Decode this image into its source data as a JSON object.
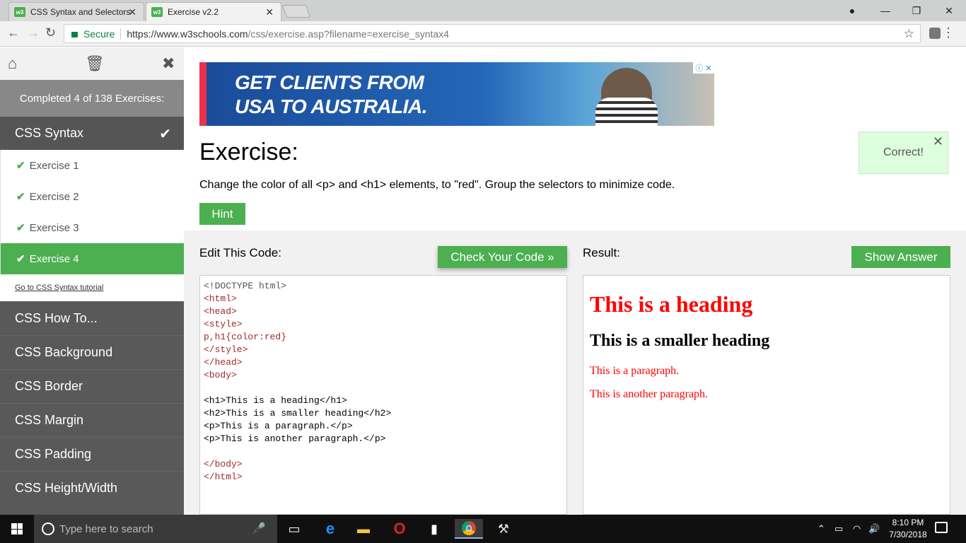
{
  "browser": {
    "tabs": [
      {
        "title": "CSS Syntax and Selectors",
        "favicon": "w3"
      },
      {
        "title": "Exercise v2.2",
        "favicon": "w3"
      }
    ],
    "secure_label": "Secure",
    "url_host": "https://www.w3schools.com",
    "url_path": "/css/exercise.asp?filename=exercise_syntax4"
  },
  "sidebar": {
    "completed": "Completed 4 of 138 Exercises:",
    "section": "CSS Syntax",
    "exercises": [
      "Exercise 1",
      "Exercise 2",
      "Exercise 3",
      "Exercise 4"
    ],
    "tutorial_link": "Go to CSS Syntax tutorial",
    "links": [
      "CSS How To...",
      "CSS Background",
      "CSS Border",
      "CSS Margin",
      "CSS Padding",
      "CSS Height/Width"
    ]
  },
  "ad": {
    "line1": "GET CLIENTS FROM",
    "line2": "USA TO AUSTRALIA."
  },
  "exercise": {
    "title": "Exercise:",
    "description": "Change the color of all <p> and <h1> elements, to \"red\". Group the selectors to minimize code.",
    "hint_label": "Hint",
    "correct_message": "Correct!"
  },
  "editor": {
    "label": "Edit This Code:",
    "check_label": "Check Your Code »",
    "code_lines": [
      "<!DOCTYPE html>",
      "<html>",
      "<head>",
      "<style>",
      "p,h1{color:red}",
      "</style>",
      "</head>",
      "<body>",
      "",
      "<h1>This is a heading</h1>",
      "<h2>This is a smaller heading</h2>",
      "<p>This is a paragraph.</p>",
      "<p>This is another paragraph.</p>",
      "",
      "</body>",
      "</html>"
    ]
  },
  "result": {
    "label": "Result:",
    "show_answer_label": "Show Answer",
    "h1": "This is a heading",
    "h2": "This is a smaller heading",
    "p1": "This is a paragraph.",
    "p2": "This is another paragraph."
  },
  "taskbar": {
    "search_placeholder": "Type here to search",
    "time": "8:10 PM",
    "date": "7/30/2018"
  }
}
